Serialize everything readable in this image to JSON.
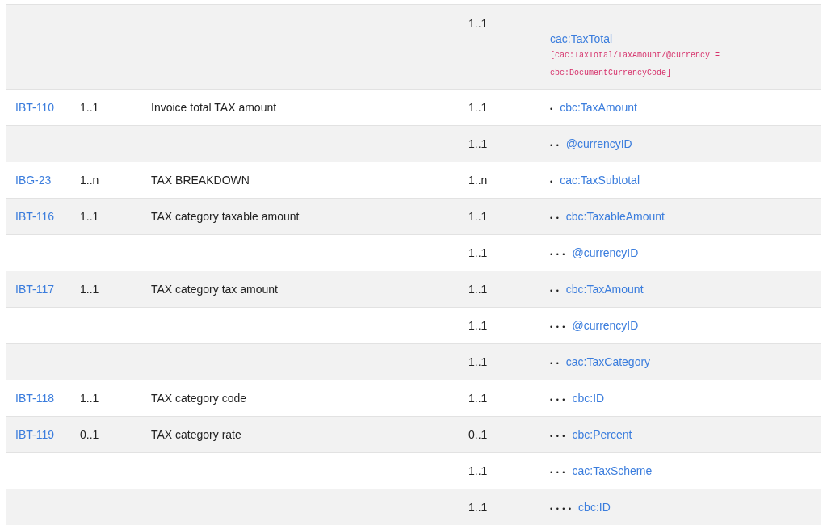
{
  "rows": [
    {
      "id": "",
      "card": "",
      "name": "",
      "card2": "1..1",
      "dots": "",
      "path": "cac:TaxTotal",
      "rule": "[cac:TaxTotal/TaxAmount/@currency = cbc:DocumentCurrencyCode]"
    },
    {
      "id": "IBT-110",
      "card": "1..1",
      "name": "Invoice total TAX amount",
      "card2": "1..1",
      "dots": "•",
      "path": "cbc:TaxAmount"
    },
    {
      "id": "",
      "card": "",
      "name": "",
      "card2": "1..1",
      "dots": "• •",
      "path": "@currencyID"
    },
    {
      "id": "IBG-23",
      "card": "1..n",
      "name": "TAX BREAKDOWN",
      "card2": "1..n",
      "dots": "•",
      "path": "cac:TaxSubtotal"
    },
    {
      "id": "IBT-116",
      "card": "1..1",
      "name": "TAX category taxable amount",
      "card2": "1..1",
      "dots": "• •",
      "path": "cbc:TaxableAmount"
    },
    {
      "id": "",
      "card": "",
      "name": "",
      "card2": "1..1",
      "dots": "• • •",
      "path": "@currencyID"
    },
    {
      "id": "IBT-117",
      "card": "1..1",
      "name": "TAX category tax amount",
      "card2": "1..1",
      "dots": "• •",
      "path": "cbc:TaxAmount"
    },
    {
      "id": "",
      "card": "",
      "name": "",
      "card2": "1..1",
      "dots": "• • •",
      "path": "@currencyID"
    },
    {
      "id": "",
      "card": "",
      "name": "",
      "card2": "1..1",
      "dots": "• •",
      "path": "cac:TaxCategory"
    },
    {
      "id": "IBT-118",
      "card": "1..1",
      "name": "TAX category code",
      "card2": "1..1",
      "dots": "• • •",
      "path": "cbc:ID"
    },
    {
      "id": "IBT-119",
      "card": "0..1",
      "name": "TAX category rate",
      "card2": "0..1",
      "dots": "• • •",
      "path": "cbc:Percent"
    },
    {
      "id": "",
      "card": "",
      "name": "",
      "card2": "1..1",
      "dots": "• • •",
      "path": "cac:TaxScheme"
    },
    {
      "id": "",
      "card": "",
      "name": "",
      "card2": "1..1",
      "dots": "• • • •",
      "path": "cbc:ID"
    }
  ]
}
